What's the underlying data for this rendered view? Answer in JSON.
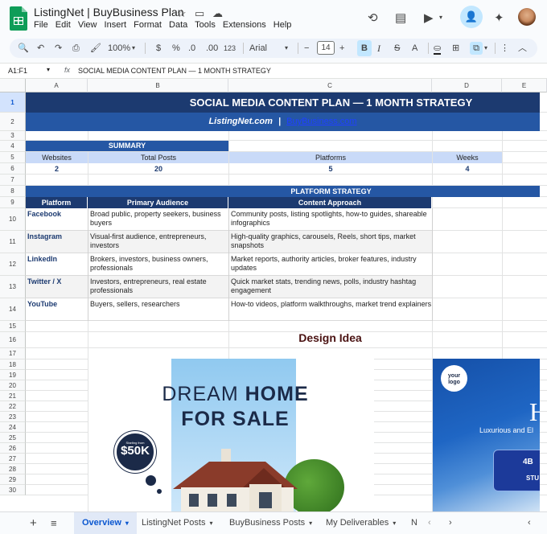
{
  "app": {
    "title": "ListingNet | BuyBusiness Plan"
  },
  "menu": [
    "File",
    "Edit",
    "View",
    "Insert",
    "Format",
    "Data",
    "Tools",
    "Extensions",
    "Help"
  ],
  "toolbar": {
    "zoom": "100%",
    "currency": "$",
    "percent": "%",
    "decimal_less": ".0",
    "decimal_more": ".00",
    "number_format": "123",
    "font": "Arial",
    "font_size": "14",
    "bold": "B",
    "italic": "I",
    "strike": "S",
    "text_color": "A"
  },
  "formula_bar": {
    "cell_ref": "A1:F1",
    "fx": "fx",
    "value": "SOCIAL MEDIA CONTENT PLAN — 1 MONTH STRATEGY"
  },
  "columns": [
    "A",
    "B",
    "C",
    "D",
    "E"
  ],
  "rows": [
    "1",
    "2",
    "3",
    "4",
    "5",
    "6",
    "7",
    "8",
    "9",
    "10",
    "11",
    "12",
    "13",
    "14",
    "15",
    "16",
    "17",
    "18",
    "19",
    "20",
    "21",
    "22",
    "23",
    "24",
    "25",
    "26",
    "27",
    "28",
    "29",
    "30"
  ],
  "sheet": {
    "title": "SOCIAL MEDIA CONTENT PLAN — 1 MONTH STRATEGY",
    "site": "ListingNet.com",
    "site_sep": "|",
    "site2": "BuyBusiness.com",
    "summary": {
      "title": "SUMMARY",
      "headers": [
        "Websites",
        "Total Posts",
        "Platforms",
        "Weeks"
      ],
      "values": [
        "2",
        "20",
        "5",
        "4"
      ]
    },
    "strategy": {
      "title": "PLATFORM STRATEGY",
      "headers": [
        "Platform",
        "Primary Audience",
        "Content Approach"
      ],
      "rows": [
        {
          "platform": "Facebook",
          "audience": "Broad public, property seekers, business buyers",
          "approach": "Community posts, listing spotlights, how-to guides, shareable infographics"
        },
        {
          "platform": "Instagram",
          "audience": "Visual-first audience, entrepreneurs, investors",
          "approach": "High-quality graphics, carousels, Reels, short tips, market snapshots"
        },
        {
          "platform": "LinkedIn",
          "audience": "Brokers, investors, business owners, professionals",
          "approach": "Market reports, authority articles, broker features, industry updates"
        },
        {
          "platform": "Twitter / X",
          "audience": "Investors, entrepreneurs, real estate professionals",
          "approach": "Quick market stats, trending news, polls, industry hashtag engagement"
        },
        {
          "platform": "YouTube",
          "audience": "Buyers, sellers, researchers",
          "approach": "How-to videos, platform walkthroughs, market trend explainers"
        }
      ]
    },
    "design_title": "Design Idea",
    "poster1": {
      "line1": "DREAM",
      "line1b": "HOME",
      "line2": "FOR SALE",
      "badge_small": "Starting from",
      "badge_price": "$50K"
    },
    "poster2": {
      "logo_line1": "your",
      "logo_line2": "logo",
      "big": "H",
      "sub": "Luxurious and El",
      "box_a": "4B",
      "box_b": "STU"
    }
  },
  "tabs": [
    {
      "label": "Overview",
      "active": true
    },
    {
      "label": "ListingNet Posts"
    },
    {
      "label": "BuyBusiness Posts"
    },
    {
      "label": "My Deliverables"
    },
    {
      "label": "N"
    }
  ]
}
